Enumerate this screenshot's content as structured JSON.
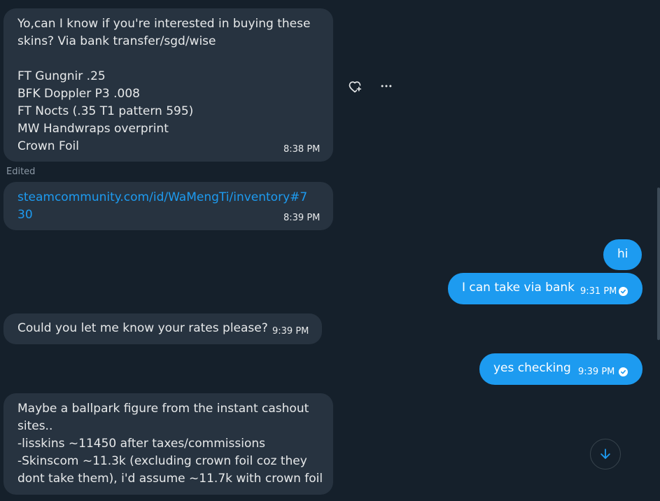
{
  "messages": [
    {
      "text": "Yo,can I know if you're interested in buying these\nskins? Via bank transfer/sgd/wise\n\nFT Gungnir .25\nBFK Doppler P3 .008\nFT Nocts (.35 T1 pattern 595)\nMW Handwraps overprint\nCrown Foil",
      "time": "8:38 PM"
    },
    {
      "edited_label": "Edited"
    },
    {
      "text": "steamcommunity.com/id/WaMengTi/inventory#7\n30",
      "time": "8:39 PM"
    },
    {
      "text": "hi"
    },
    {
      "text": "I can take via bank",
      "time": "9:31 PM",
      "status_icon": "check-circle-icon"
    },
    {
      "text": "Could you let me know your rates please?",
      "time": "9:39 PM"
    },
    {
      "text": "yes checking",
      "time": "9:39 PM",
      "status_icon": "check-circle-icon"
    },
    {
      "text": "Maybe a ballpark figure from the instant cashout\nsites..\n-lisskins ~11450 after taxes/commissions\n-Skinscom ~11.3k (excluding crown foil coz they\ndont take them), i'd assume ~11.7k with crown foil"
    }
  ],
  "actions": {
    "react_icon": "heart-plus-icon",
    "more_icon": "more-horizontal-icon"
  },
  "scroll_down_icon": "arrow-down-icon",
  "colors": {
    "background": "#15202b",
    "incoming_bubble": "#273340",
    "outgoing_bubble": "#1d9bf0",
    "link": "#1d9bf0",
    "muted": "#8b98a5"
  }
}
